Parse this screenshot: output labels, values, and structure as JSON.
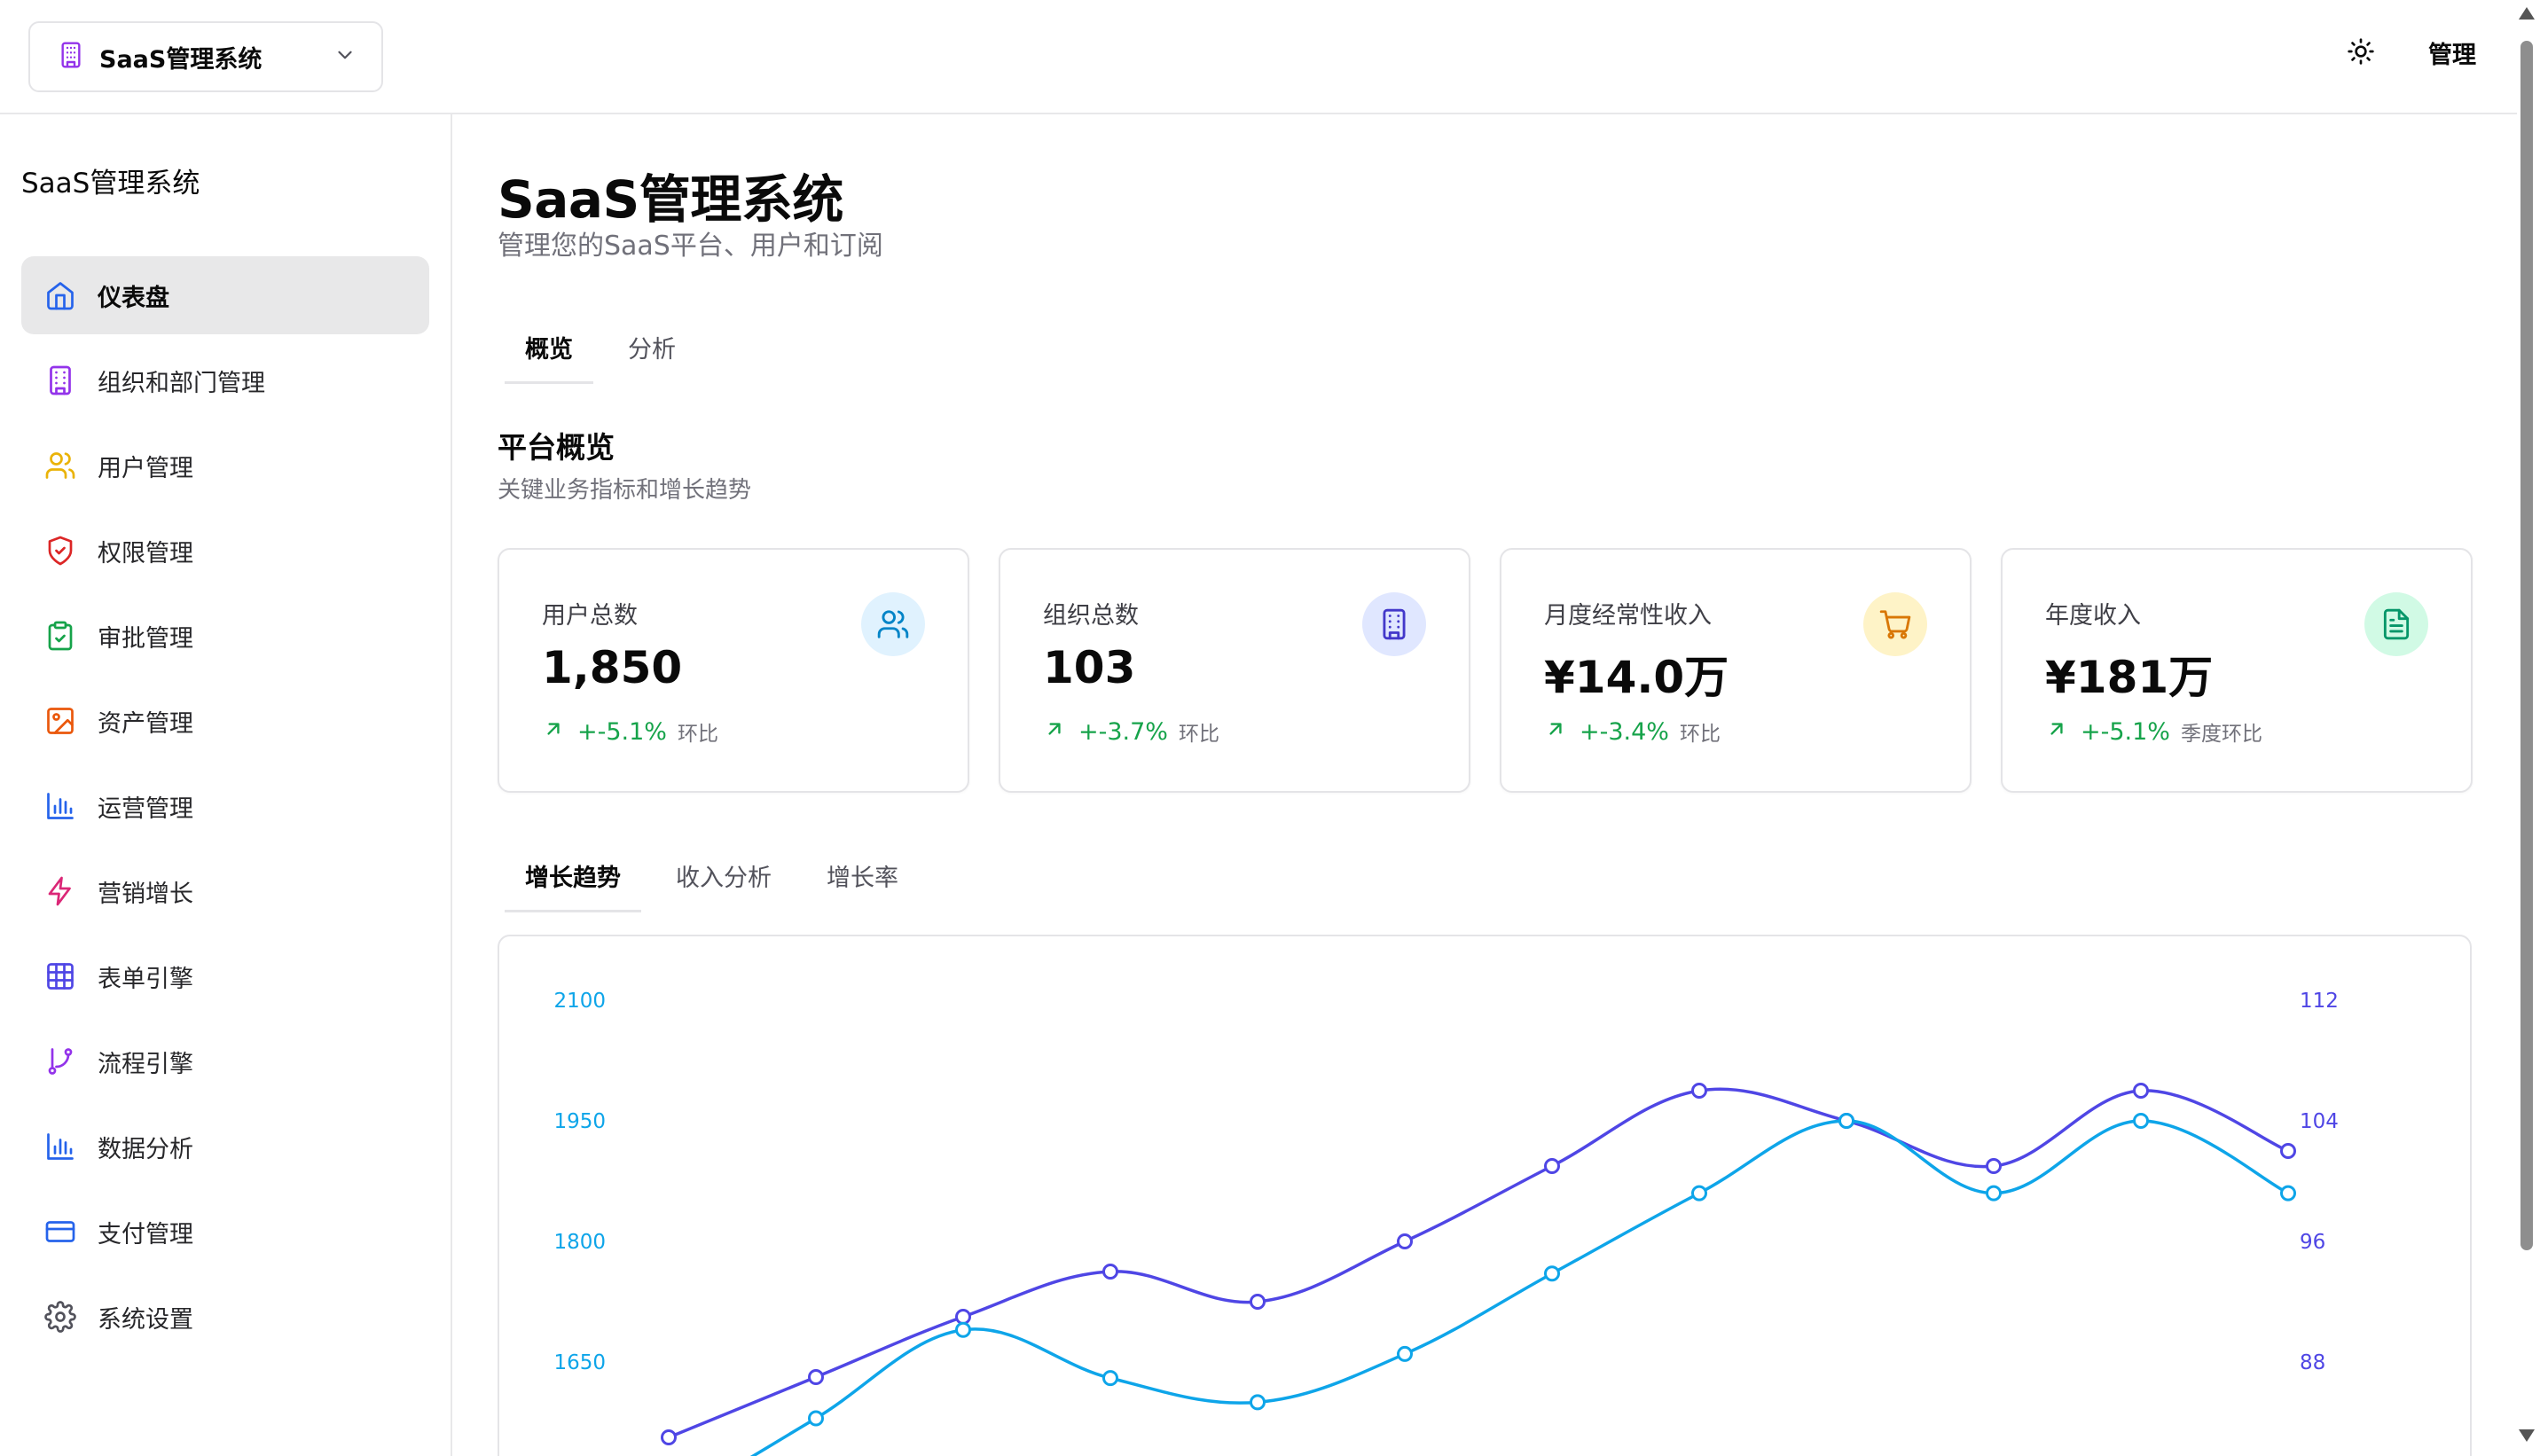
{
  "header": {
    "org_switcher": {
      "name": "SaaS管理系统",
      "icon": "building-icon"
    },
    "theme_toggle_icon": "sun-icon",
    "manage_label": "管理"
  },
  "sidebar": {
    "brand": "SaaS管理系统",
    "items": [
      {
        "label": "仪表盘",
        "icon": "home-icon",
        "color": "#2563eb",
        "active": true
      },
      {
        "label": "组织和部门管理",
        "icon": "building-icon",
        "color": "#9333ea"
      },
      {
        "label": "用户管理",
        "icon": "users-icon",
        "color": "#eab308"
      },
      {
        "label": "权限管理",
        "icon": "shield-icon",
        "color": "#dc2626"
      },
      {
        "label": "审批管理",
        "icon": "clipboard-check-icon",
        "color": "#16a34a"
      },
      {
        "label": "资产管理",
        "icon": "image-icon",
        "color": "#ea580c"
      },
      {
        "label": "运营管理",
        "icon": "bar-chart-icon",
        "color": "#2563eb"
      },
      {
        "label": "营销增长",
        "icon": "zap-icon",
        "color": "#db2777"
      },
      {
        "label": "表单引擎",
        "icon": "table-icon",
        "color": "#4f46e5"
      },
      {
        "label": "流程引擎",
        "icon": "git-branch-icon",
        "color": "#9333ea"
      },
      {
        "label": "数据分析",
        "icon": "bar-chart-icon",
        "color": "#2563eb"
      },
      {
        "label": "支付管理",
        "icon": "credit-card-icon",
        "color": "#2563eb"
      },
      {
        "label": "系统设置",
        "icon": "gear-icon",
        "color": "#52525b"
      }
    ]
  },
  "main": {
    "title": "SaaS管理系统",
    "subtitle": "管理您的SaaS平台、用户和订阅",
    "tabs": [
      {
        "label": "概览",
        "active": true
      },
      {
        "label": "分析",
        "active": false
      }
    ],
    "section": {
      "title": "平台概览",
      "desc": "关键业务指标和增长趋势"
    },
    "stats": [
      {
        "label": "用户总数",
        "value": "1,850",
        "delta": "+-5.1%",
        "compare": "环比",
        "icon": "users-icon",
        "icon_color": "#0284c7",
        "icon_bg": "#e0f2fe"
      },
      {
        "label": "组织总数",
        "value": "103",
        "delta": "+-3.7%",
        "compare": "环比",
        "icon": "building-icon",
        "icon_color": "#4338ca",
        "icon_bg": "#e0e7ff"
      },
      {
        "label": "月度经常性收入",
        "value": "¥14.0万",
        "delta": "+-3.4%",
        "compare": "环比",
        "icon": "cart-icon",
        "icon_color": "#d97706",
        "icon_bg": "#fef3c7"
      },
      {
        "label": "年度收入",
        "value": "¥181万",
        "delta": "+-5.1%",
        "compare": "季度环比",
        "icon": "file-text-icon",
        "icon_color": "#059669",
        "icon_bg": "#d1fae5"
      }
    ],
    "chart_tabs": [
      {
        "label": "增长趋势",
        "active": true
      },
      {
        "label": "收入分析",
        "active": false
      },
      {
        "label": "增长率",
        "active": false
      }
    ]
  },
  "chart_data": {
    "type": "line",
    "left_axis": {
      "ticks": [
        "2100",
        "1950",
        "1800",
        "1650"
      ],
      "range": [
        1500,
        2100
      ],
      "color": "#0ea5e9"
    },
    "right_axis": {
      "ticks": [
        "112",
        "104",
        "96",
        "88"
      ],
      "range": [
        80,
        112
      ],
      "color": "#4f46e5"
    },
    "series": [
      {
        "axis": "right",
        "color": "#4f46e5",
        "values": [
          83,
          87,
          91,
          94,
          92,
          96,
          101,
          106,
          104,
          101,
          106,
          102
        ]
      },
      {
        "axis": "left",
        "color": "#0ea5e9",
        "values": [
          1470,
          1580,
          1690,
          1630,
          1600,
          1660,
          1760,
          1860,
          1950,
          1860,
          1950,
          1860
        ]
      }
    ]
  }
}
